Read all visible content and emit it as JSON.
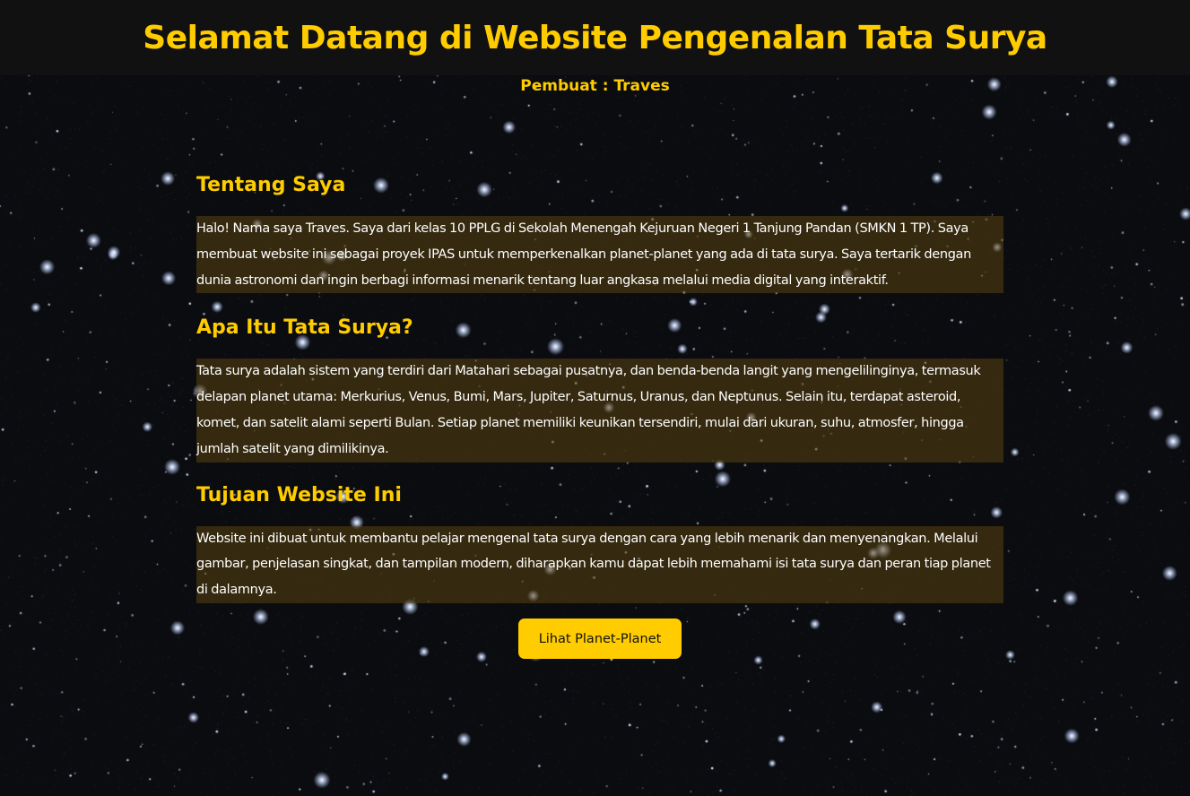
{
  "header": {
    "title": "Selamat Datang di Website Pengenalan Tata Surya",
    "author": "Pembuat : Traves"
  },
  "sections": [
    {
      "title": "Tentang Saya",
      "text": "Halo! Nama saya Traves. Saya dari kelas 10 PPLG di Sekolah Menengah Kejuruan Negeri 1 Tanjung Pandan (SMKN 1 TP). Saya membuat website ini sebagai proyek IPAS untuk memperkenalkan planet-planet yang ada di tata surya. Saya tertarik dengan dunia astronomi dan ingin berbagi informasi menarik tentang luar angkasa melalui media digital yang interaktif."
    },
    {
      "title": "Apa Itu Tata Surya?",
      "text": "Tata surya adalah sistem yang terdiri dari Matahari sebagai pusatnya, dan benda-benda langit yang mengelilinginya, termasuk delapan planet utama: Merkurius, Venus, Bumi, Mars, Jupiter, Saturnus, Uranus, dan Neptunus. Selain itu, terdapat asteroid, komet, dan satelit alami seperti Bulan. Setiap planet memiliki keunikan tersendiri, mulai dari ukuran, suhu, atmosfer, hingga jumlah satelit yang dimilikinya."
    },
    {
      "title": "Tujuan Website Ini",
      "text": "Website ini dibuat untuk membantu pelajar mengenal tata surya dengan cara yang lebih menarik dan menyenangkan. Melalui gambar, penjelasan singkat, dan tampilan modern, diharapkan kamu dapat lebih memahami isi tata surya dan peran tiap planet di dalamnya."
    }
  ],
  "button": {
    "label": "Lihat Planet-Planet"
  },
  "colors": {
    "accent": "#ffcc00",
    "header_bg": "#111111",
    "page_bg": "#0a0c10",
    "text_box_bg": "rgba(90, 65, 15, 0.55)",
    "text": "#ffffff"
  },
  "background": {
    "image": "starfield"
  }
}
